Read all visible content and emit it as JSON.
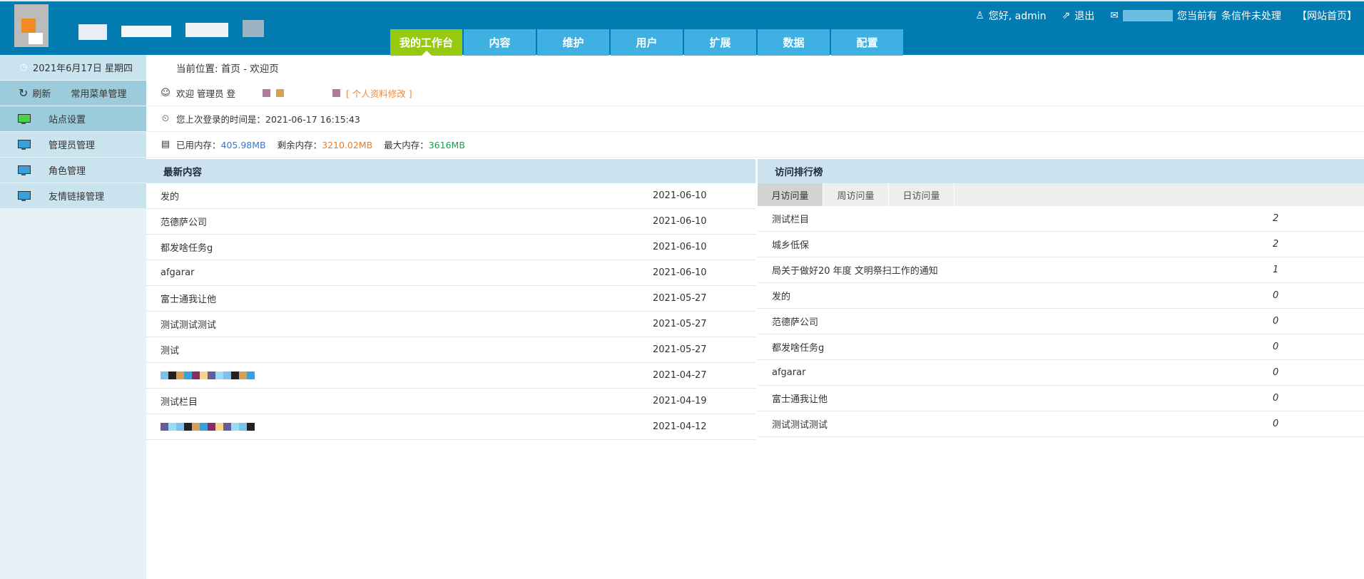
{
  "header": {
    "greeting": "您好, admin",
    "logout": "退出",
    "message_prefix": "您当前有",
    "message_suffix": "条信件未处理",
    "home_link": "【网站首页】",
    "nav": [
      "我的工作台",
      "内容",
      "维护",
      "用户",
      "扩展",
      "数据",
      "配置"
    ],
    "active_nav": 0
  },
  "sidebar": {
    "date": "2021年6月17日 星期四",
    "refresh": "刷新",
    "menu_manage": "常用菜单管理",
    "items": [
      "站点设置",
      "管理员管理",
      "角色管理",
      "友情链接管理"
    ]
  },
  "info": {
    "breadcrumb": "当前位置: 首页 - 欢迎页",
    "welcome": "欢迎 管理员  登",
    "profile_link": "[ 个人资料修改 ]",
    "last_login_label": "您上次登录的时间是：",
    "last_login": "2021-06-17 16:15:43",
    "used_label": "已用内存：",
    "used": "405.98MB",
    "free_label": "剩余内存：",
    "free": "3210.02MB",
    "max_label": "最大内存：",
    "max": "3616MB"
  },
  "latest": {
    "title": "最新内容",
    "rows": [
      {
        "title": "发的",
        "date": "2021-06-10"
      },
      {
        "title": "范德萨公司",
        "date": "2021-06-10"
      },
      {
        "title": "都发啥任务g",
        "date": "2021-06-10"
      },
      {
        "title": "afgarar",
        "date": "2021-06-10"
      },
      {
        "title": "富士通我让他",
        "date": "2021-05-27"
      },
      {
        "title": "测试测试测试",
        "date": "2021-05-27"
      },
      {
        "title": "测试",
        "date": "2021-05-27"
      },
      {
        "title": "",
        "date": "2021-04-27"
      },
      {
        "title": "测试栏目",
        "date": "2021-04-19"
      },
      {
        "title": "",
        "date": "2021-04-12"
      }
    ]
  },
  "ranking": {
    "title": "访问排行榜",
    "tabs": [
      "月访问量",
      "周访问量",
      "日访问量"
    ],
    "rows": [
      {
        "title": "测试栏目",
        "count": "2"
      },
      {
        "title": "城乡低保",
        "count": "2"
      },
      {
        "title": "局关于做好20 年度 文明祭扫工作的通知",
        "count": "1"
      },
      {
        "title": "发的",
        "count": "0"
      },
      {
        "title": "范德萨公司",
        "count": "0"
      },
      {
        "title": "都发啥任务g",
        "count": "0"
      },
      {
        "title": "afgarar",
        "count": "0"
      },
      {
        "title": "富士通我让他",
        "count": "0"
      },
      {
        "title": "测试测试测试",
        "count": "0"
      }
    ]
  },
  "colors": {
    "header": "#027bb0",
    "tab": "#3fb0e2",
    "active_tab": "#96c90f",
    "panel_head": "#cce3ef"
  }
}
